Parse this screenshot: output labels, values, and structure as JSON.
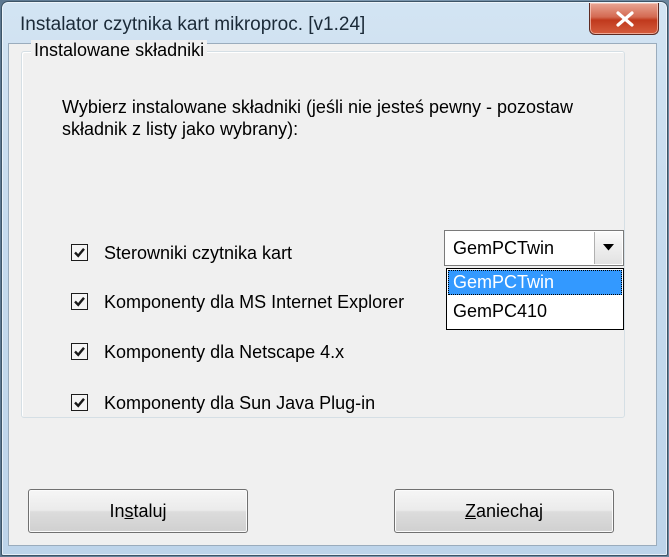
{
  "window": {
    "title": "Instalator czytnika kart mikroproc. [v1.24]",
    "close_label": "X"
  },
  "group": {
    "legend": "Instalowane składniki",
    "description": "Wybierz instalowane składniki (jeśli nie jesteś pewny - pozostaw składnik z listy jako wybrany):"
  },
  "components": [
    {
      "label": "Sterowniki czytnika kart",
      "checked": true
    },
    {
      "label": "Komponenty dla MS Internet Explorer",
      "checked": true
    },
    {
      "label": "Komponenty dla Netscape 4.x",
      "checked": true
    },
    {
      "label": "Komponenty dla Sun Java Plug-in",
      "checked": true
    }
  ],
  "reader_select": {
    "value": "GemPCTwin",
    "options": [
      "GemPCTwin",
      "GemPC410"
    ],
    "highlighted": "GemPCTwin"
  },
  "buttons": {
    "install": {
      "before": "In",
      "mnemonic": "s",
      "after": "taluj"
    },
    "cancel": {
      "before": "",
      "mnemonic": "Z",
      "after": "aniechaj"
    }
  },
  "colors": {
    "selection": "#3399ff",
    "close_button": "#c0391d",
    "frame": "#c6dbee"
  }
}
